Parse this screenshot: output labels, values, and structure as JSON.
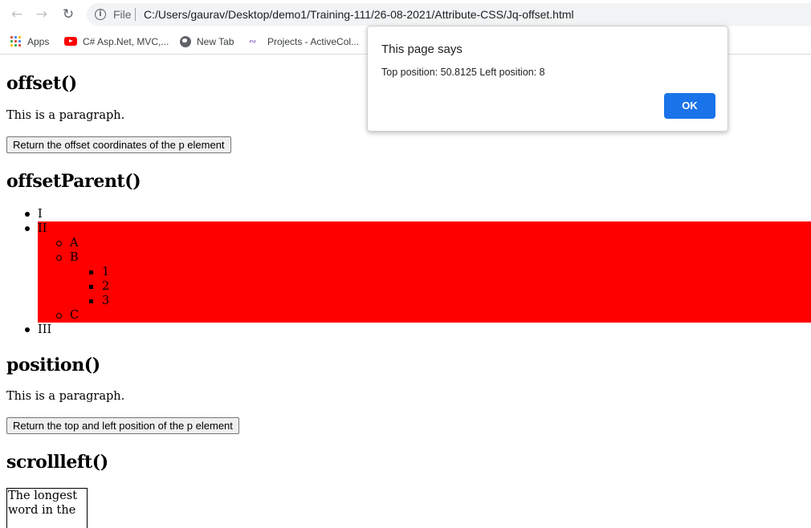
{
  "browser": {
    "scheme_label": "File",
    "url": "C:/Users/gaurav/Desktop/demo1/Training-111/26-08-2021/Attribute-CSS/Jq-offset.html",
    "bookmarks": [
      {
        "label": "Apps",
        "icon": "apps-grid-icon"
      },
      {
        "label": "C# Asp.Net, MVC,...",
        "icon": "youtube-icon"
      },
      {
        "label": "New Tab",
        "icon": "globe-icon"
      },
      {
        "label": "Projects - ActiveCol...",
        "icon": "projects-icon"
      }
    ]
  },
  "page": {
    "offset": {
      "heading": "offset()",
      "paragraph": "This is a paragraph.",
      "button": "Return the offset coordinates of the p element"
    },
    "offset_parent": {
      "heading": "offsetParent()",
      "list": {
        "i": "I",
        "ii": "II",
        "a": "A",
        "b": "B",
        "one": "1",
        "two": "2",
        "three": "3",
        "c": "C",
        "iii": "III"
      },
      "highlight_color": "#ff0000"
    },
    "position": {
      "heading": "position()",
      "paragraph": "This is a paragraph.",
      "button": "Return the top and left position of the p element"
    },
    "scrollleft": {
      "heading": "scrollleft()",
      "box_text": "The longest word in the"
    }
  },
  "dialog": {
    "title": "This page says",
    "message": "Top position: 50.8125 Left position: 8",
    "ok_label": "OK",
    "ok_color": "#1a73e8"
  }
}
